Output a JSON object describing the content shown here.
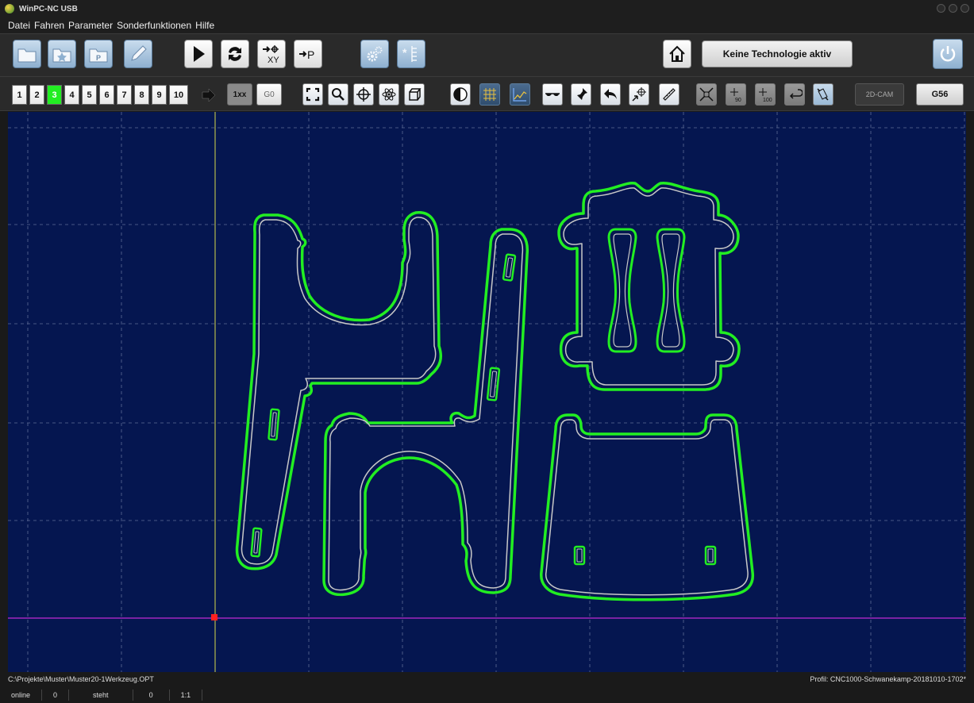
{
  "window": {
    "title": "WinPC-NC USB"
  },
  "menu": [
    "Datei",
    "Fahren",
    "Parameter",
    "Sonderfunktionen",
    "Hilfe"
  ],
  "toolbar1": {
    "icons": [
      "folder-open-icon",
      "favorites-icon",
      "program-file-icon",
      "edit-pencil-icon",
      "play-icon",
      "refresh-icon",
      "goto-xy-icon",
      "goto-p-icon",
      "settings-gears-icon",
      "special-axes-icon",
      "home-icon",
      "power-icon"
    ],
    "goto_xy_label": "XY",
    "goto_p_label": "P",
    "technology_status": "Keine Technologie aktiv"
  },
  "toolbar2": {
    "numbers": [
      "1",
      "2",
      "3",
      "4",
      "5",
      "6",
      "7",
      "8",
      "9",
      "10"
    ],
    "active_number": "3",
    "mode_1xx": "1xx",
    "mode_g0": "G0",
    "cam_label": "2D-CAM",
    "g56_label": "G56",
    "move90_label": "90",
    "move100_label": "100"
  },
  "colors": {
    "canvas_bg": "#051650",
    "outline_green": "#22ee22",
    "contour_white": "#c8c8c8",
    "axis_y": "#d8d84a",
    "axis_x": "#c02ad2",
    "origin_marker": "#ff2020"
  },
  "status": {
    "file_path": "C:\\Projekte\\Muster\\Muster20-1Werkzeug.OPT",
    "profile": "Profil: CNC1000-Schwanekamp-20181010-1702*",
    "connection": "online",
    "value1": "0",
    "state": "steht",
    "value2": "0",
    "scale": "1:1"
  }
}
